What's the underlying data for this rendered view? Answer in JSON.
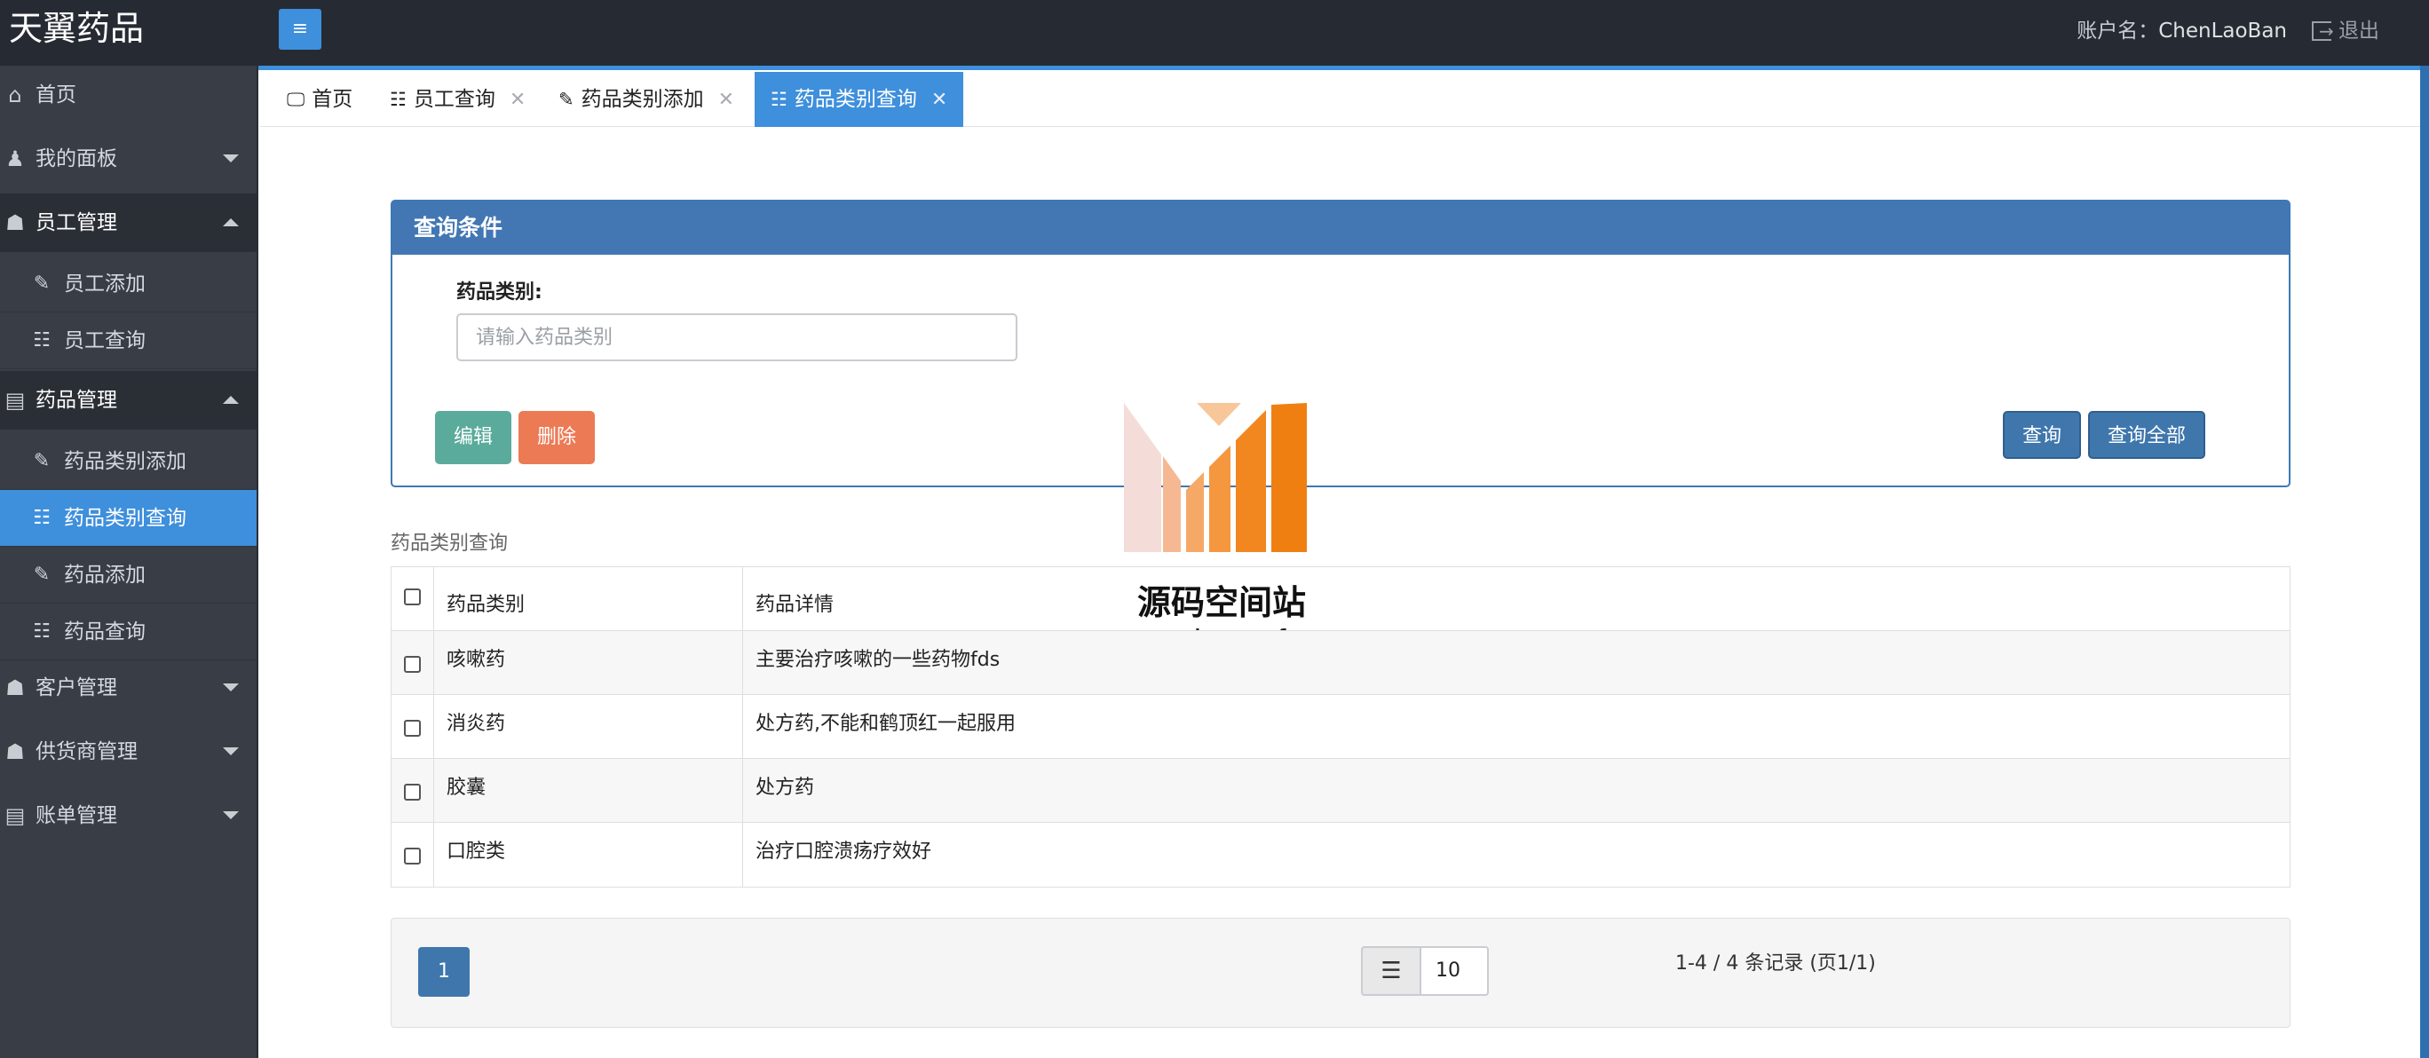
{
  "app": {
    "title": "天翼药品"
  },
  "header": {
    "account_label": "账户名：",
    "account_name": "ChenLaoBan",
    "logout_label": "退出"
  },
  "sidebar": {
    "items": [
      {
        "label": "首页",
        "icon": "home-icon"
      },
      {
        "label": "我的面板",
        "icon": "user-icon"
      },
      {
        "label": "员工管理",
        "icon": "users-icon"
      },
      {
        "label": "员工添加",
        "icon": "edit-icon"
      },
      {
        "label": "员工查询",
        "icon": "list-icon"
      },
      {
        "label": "药品管理",
        "icon": "file-icon"
      },
      {
        "label": "药品类别添加",
        "icon": "edit-icon"
      },
      {
        "label": "药品类别查询",
        "icon": "list-icon"
      },
      {
        "label": "药品添加",
        "icon": "edit-icon"
      },
      {
        "label": "药品查询",
        "icon": "list-icon"
      },
      {
        "label": "客户管理",
        "icon": "users-icon"
      },
      {
        "label": "供货商管理",
        "icon": "users-icon"
      },
      {
        "label": "账单管理",
        "icon": "file-icon"
      }
    ]
  },
  "tabs": [
    {
      "label": "首页"
    },
    {
      "label": "员工查询"
    },
    {
      "label": "药品类别添加"
    },
    {
      "label": "药品类别查询"
    }
  ],
  "query": {
    "title": "查询条件",
    "field_label": "药品类别:",
    "placeholder": "请输入药品类别",
    "edit_label": "编辑",
    "delete_label": "删除",
    "query_label": "查询",
    "query_all_label": "查询全部"
  },
  "watermark": {
    "name": "源码空间站",
    "url": "www.shuyue.fun"
  },
  "table": {
    "caption": "药品类别查询",
    "headers": [
      "药品类别",
      "药品详情"
    ],
    "rows": [
      {
        "category": "咳嗽药",
        "detail": "主要治疗咳嗽的一些药物fds"
      },
      {
        "category": "消炎药",
        "detail": "处方药,不能和鹤顶红一起服用"
      },
      {
        "category": "胶囊",
        "detail": "处方药"
      },
      {
        "category": "口腔类",
        "detail": "治疗口腔溃疡疗效好"
      }
    ]
  },
  "pagination": {
    "current_page": "1",
    "page_size": "10",
    "info": "1-4 / 4 条记录 (页1/1)"
  },
  "colors": {
    "topbar": "#262b33",
    "sidebar": "#383d46",
    "accent": "#3e8fdc",
    "panel_head": "#4277b3",
    "edit": "#5aab9b",
    "delete": "#ec7a55"
  }
}
